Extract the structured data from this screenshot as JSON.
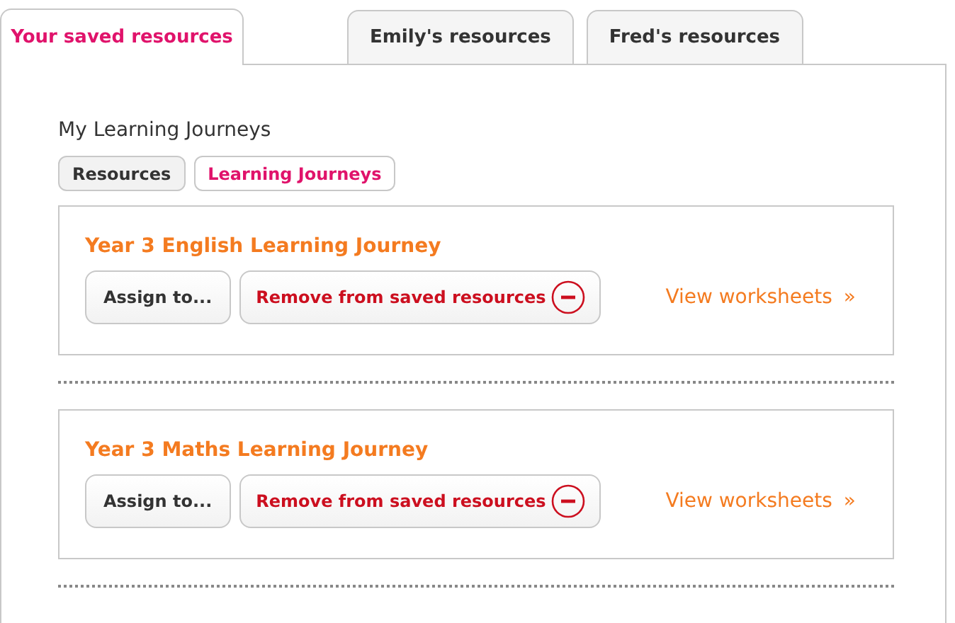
{
  "tabs": [
    {
      "label": "Your saved resources",
      "selected": true
    },
    {
      "label": "Emily's resources",
      "selected": false
    },
    {
      "label": "Fred's resources",
      "selected": false
    }
  ],
  "heading": "My Learning Journeys",
  "filters": [
    {
      "label": "Resources",
      "selected": false
    },
    {
      "label": "Learning Journeys",
      "selected": true
    }
  ],
  "journeys": [
    {
      "title": "Year 3 English Learning Journey",
      "assign": "Assign to...",
      "remove": "Remove from saved resources",
      "link": "View worksheets",
      "link_arrow": "»"
    },
    {
      "title": "Year 3 Maths Learning Journey",
      "assign": "Assign to...",
      "remove": "Remove from saved resources",
      "link": "View worksheets",
      "link_arrow": "»"
    }
  ]
}
